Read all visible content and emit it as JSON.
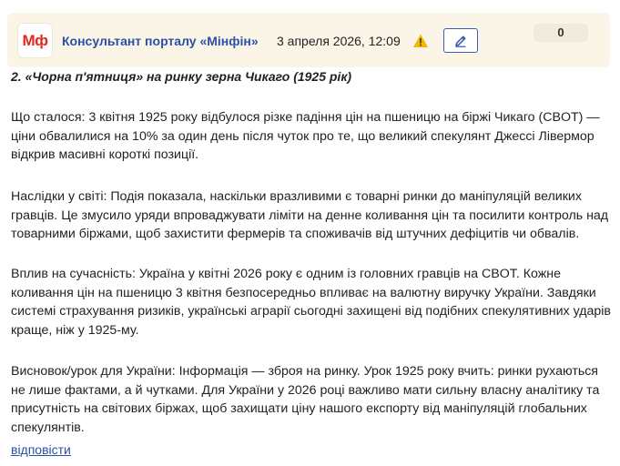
{
  "header": {
    "logo_text": "Мф",
    "author": "Консультант порталу «Мінфін»",
    "date": "3 апреля 2026, 12:09",
    "warning_icon": "warning-triangle-icon",
    "edit_icon": "pencil-icon",
    "score": "0"
  },
  "post": {
    "title": "2. «Чорна п'ятниця» на ринку зерна Чикаго (1925 рік)",
    "paragraphs": [
      "Що сталося: 3 квітня 1925 року відбулося різке падіння цін на пшеницю на біржі Чикаго (CBOT) — ціни обвалилися на 10% за один день після чуток про те, що великий спекулянт Джессі Лівермор відкрив масивні короткі позиції.",
      "Наслідки у світі: Подія показала, наскільки вразливими є товарні ринки до маніпуляцій великих гравців. Це змусило уряди впроваджувати ліміти на денне коливання цін та посилити контроль над товарними біржами, щоб захистити фермерів та споживачів від штучних дефіцитів чи обвалів.",
      "Вплив на сучасність: Україна у квітні 2026 року є одним із головних гравців на CBOT. Кожне коливання цін на пшеницю 3 квітня безпосередньо впливає на валютну виручку України. Завдяки системі страхування ризиків, українські аграрії сьогодні захищені від подібних спекулятивних ударів краще, ніж у 1925-му.",
      "Висновок/урок для України: Інформація — зброя на ринку. Урок 1925 року вчить: ринки рухаються не лише фактами, а й чутками. Для України у 2026 році важливо мати сильну власну аналітику та присутність на світових біржах, щоб захищати ціну нашого експорту від маніпуляцій глобальних спекулянтів."
    ],
    "reply_label": "відповісти"
  },
  "colors": {
    "header_bg": "#fbf5e8",
    "brand_red": "#e02a1f",
    "link_blue": "#2b4fa6",
    "warning_yellow": "#f2b600"
  }
}
